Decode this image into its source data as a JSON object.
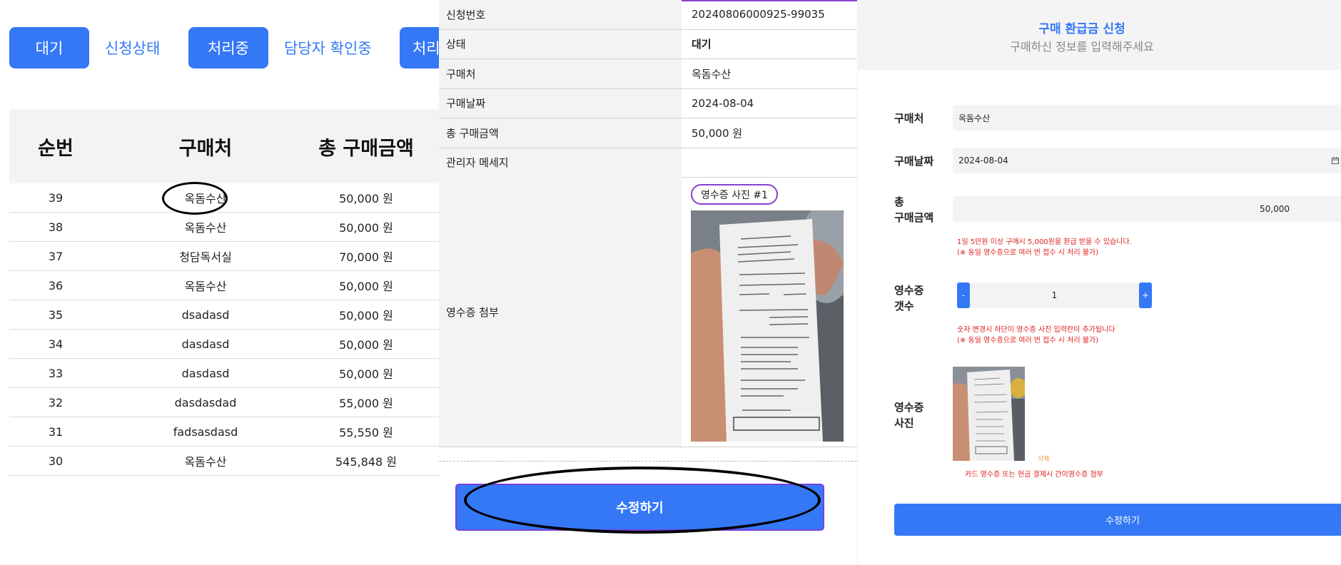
{
  "list_panel": {
    "status_buttons": [
      {
        "button": "대기",
        "label": "신청상태"
      },
      {
        "button": "처리중",
        "label": "담당자 확인중"
      },
      {
        "button": "처리완"
      }
    ],
    "columns": [
      "순번",
      "구매처",
      "총 구매금액"
    ],
    "rows": [
      [
        "39",
        "옥돔수산",
        "50,000 원"
      ],
      [
        "38",
        "옥돔수산",
        "50,000 원"
      ],
      [
        "37",
        "청담독서실",
        "70,000 원"
      ],
      [
        "36",
        "옥돔수산",
        "50,000 원"
      ],
      [
        "35",
        "dsadasd",
        "50,000 원"
      ],
      [
        "34",
        "dasdasd",
        "50,000 원"
      ],
      [
        "33",
        "dasdasd",
        "50,000 원"
      ],
      [
        "32",
        "dasdasdad",
        "55,000 원"
      ],
      [
        "31",
        "fadsasdasd",
        "55,550 원"
      ],
      [
        "30",
        "옥돔수산",
        "545,848 원"
      ]
    ]
  },
  "detail_panel": {
    "fields": [
      {
        "key": "신청번호",
        "value": "20240806000925-99035"
      },
      {
        "key": "상태",
        "value": "대기"
      },
      {
        "key": "구매처",
        "value": "옥돔수산"
      },
      {
        "key": "구매날짜",
        "value": "2024-08-04"
      },
      {
        "key": "총 구매금액",
        "value": "50,000 원"
      },
      {
        "key": "관리자 메세지",
        "value": ""
      }
    ],
    "attachment_label": "영수증 첨부",
    "photo_badge": "영수증 사진 #1",
    "edit_button": "수정하기"
  },
  "form_panel": {
    "title": "구매 환급금 신청",
    "subtitle": "구매하신 정보를 입력해주세요",
    "store_label": "구매처",
    "store_value": "옥돔수산",
    "date_label": "구매날짜",
    "date_value": "2024-08-04",
    "amount_label_1": "총",
    "amount_label_2": "구매금액",
    "amount_value": "50,000",
    "amount_note_1": "1일 5만원 이상 구매시 5,000원을 환급 받을 수 있습니다.",
    "amount_note_2": "(※ 동일 영수증으로 여러 번 접수 시 처리 불가)",
    "count_label_1": "영수증",
    "count_label_2": "갯수",
    "count_minus": "-",
    "count_value": "1",
    "count_plus": "+",
    "count_note_1": "숫자 변경시 하단이 영수증 사진 입력란이 추가됩니다",
    "count_note_2": "(※ 동일 영수증으로 여러 번 접수 시 처리 불가)",
    "photo_label_1": "영수증",
    "photo_label_2": "사진",
    "delete_label": "삭제",
    "photo_note": "카드 영수증 또는 현금 결제시 간이영수증 첨부",
    "submit_button": "수정하기"
  },
  "colors": {
    "accent": "#3478f6",
    "highlight": "#8a3fd0",
    "warning": "#e02020"
  },
  "icons": [
    "calendar-icon"
  ]
}
